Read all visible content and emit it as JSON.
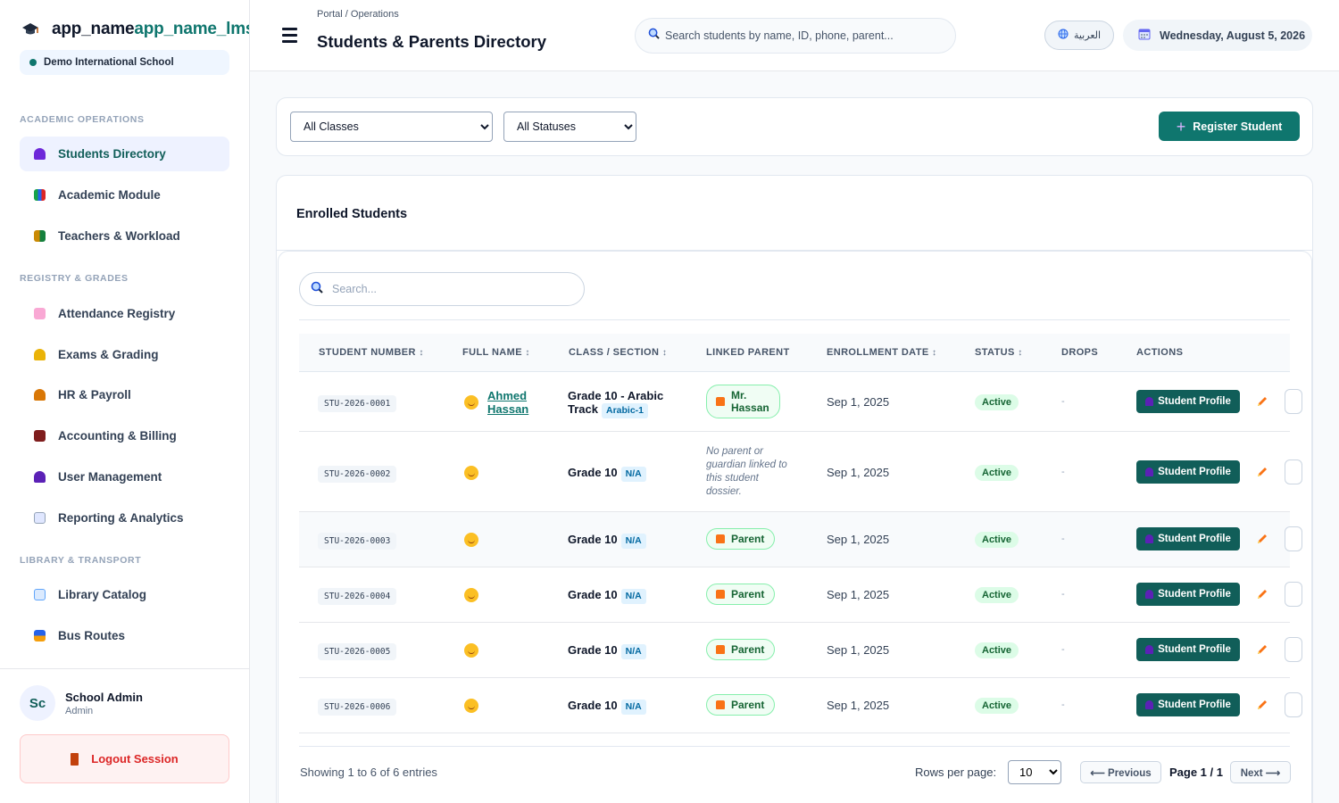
{
  "sidebar": {
    "brand_prefix": "app_name",
    "brand_accent": "app_name_lms",
    "school": "Demo International School",
    "sections": [
      {
        "label": "ACADEMIC OPERATIONS"
      },
      {
        "label": "REGISTRY & GRADES"
      },
      {
        "label": "LIBRARY & TRANSPORT"
      }
    ],
    "items": [
      {
        "label": "Students Directory",
        "icon": "students-icon",
        "active": true
      },
      {
        "label": "Academic Module",
        "icon": "books-icon"
      },
      {
        "label": "Teachers & Workload",
        "icon": "teachers-icon"
      },
      {
        "label": "Attendance Registry",
        "icon": "attendance-icon"
      },
      {
        "label": "Exams & Grading",
        "icon": "exams-icon"
      },
      {
        "label": "HR & Payroll",
        "icon": "hr-icon"
      },
      {
        "label": "Accounting & Billing",
        "icon": "briefcase-icon"
      },
      {
        "label": "User Management",
        "icon": "user-icon"
      },
      {
        "label": "Reporting & Analytics",
        "icon": "chart-icon"
      },
      {
        "label": "Library Catalog",
        "icon": "book-icon"
      },
      {
        "label": "Bus Routes",
        "icon": "bus-icon"
      }
    ],
    "user": {
      "initials": "Sc",
      "name": "School Admin",
      "role": "Admin"
    },
    "logout_label": "Logout Session"
  },
  "header": {
    "breadcrumb": "Portal / Operations",
    "title": "Students & Parents Directory",
    "search_placeholder": "Search students by name, ID, phone, parent...",
    "lang_label": "العربية",
    "date": "Wednesday, August 5, 2026"
  },
  "filters": {
    "class_selected": "All Classes",
    "status_selected": "All Statuses",
    "register_label": "Register Student"
  },
  "table": {
    "title": "Enrolled Students",
    "search_placeholder": "Search...",
    "columns": [
      {
        "label": "STUDENT NUMBER",
        "sort": "↕"
      },
      {
        "label": "FULL NAME",
        "sort": "↕"
      },
      {
        "label": "CLASS / SECTION",
        "sort": "↕"
      },
      {
        "label": "LINKED PARENT",
        "sort": ""
      },
      {
        "label": "ENROLLMENT DATE",
        "sort": "↕"
      },
      {
        "label": "STATUS",
        "sort": "↕"
      },
      {
        "label": "DROPS",
        "sort": ""
      },
      {
        "label": "ACTIONS",
        "sort": ""
      }
    ],
    "rows": [
      {
        "id": "STU-2026-0001",
        "name_line1": "Ahmed",
        "name_line2": "Hassan",
        "class_line1": "Grade 10 - Arabic",
        "class_line2": "Track",
        "section": "Arabic-1",
        "parent_line1": "Mr.",
        "parent_line2": "Hassan",
        "enroll": "Sep 1, 2025",
        "status": "Active",
        "drops": "-",
        "action": "Student Profile"
      },
      {
        "id": "STU-2026-0002",
        "class_line1": "Grade 10",
        "section": "N/A",
        "no_parent": "No parent or guardian linked to this student dossier.",
        "enroll": "Sep 1, 2025",
        "status": "Active",
        "drops": "-",
        "action": "Student Profile"
      },
      {
        "id": "STU-2026-0003",
        "class_line1": "Grade 10",
        "section": "N/A",
        "parent": "Parent",
        "enroll": "Sep 1, 2025",
        "status": "Active",
        "drops": "-",
        "action": "Student Profile"
      },
      {
        "id": "STU-2026-0004",
        "class_line1": "Grade 10",
        "section": "N/A",
        "parent": "Parent",
        "enroll": "Sep 1, 2025",
        "status": "Active",
        "drops": "-",
        "action": "Student Profile"
      },
      {
        "id": "STU-2026-0005",
        "class_line1": "Grade 10",
        "section": "N/A",
        "parent": "Parent",
        "enroll": "Sep 1, 2025",
        "status": "Active",
        "drops": "-",
        "action": "Student Profile"
      },
      {
        "id": "STU-2026-0006",
        "class_line1": "Grade 10",
        "section": "N/A",
        "parent": "Parent",
        "enroll": "Sep 1, 2025",
        "status": "Active",
        "drops": "-",
        "action": "Student Profile"
      }
    ],
    "footer": {
      "showing": "Showing 1 to 6 of 6 entries",
      "rows_per_page_label": "Rows per page:",
      "rows_per_page": "10",
      "prev_label": "⟵ Previous",
      "page_indicator": "Page 1 / 1",
      "next_label": "Next ⟶"
    }
  },
  "colors": {
    "accent": "#0f766e",
    "active_bg": "#eef2ff",
    "status_bg": "#dcfce7",
    "danger": "#dc2626"
  }
}
